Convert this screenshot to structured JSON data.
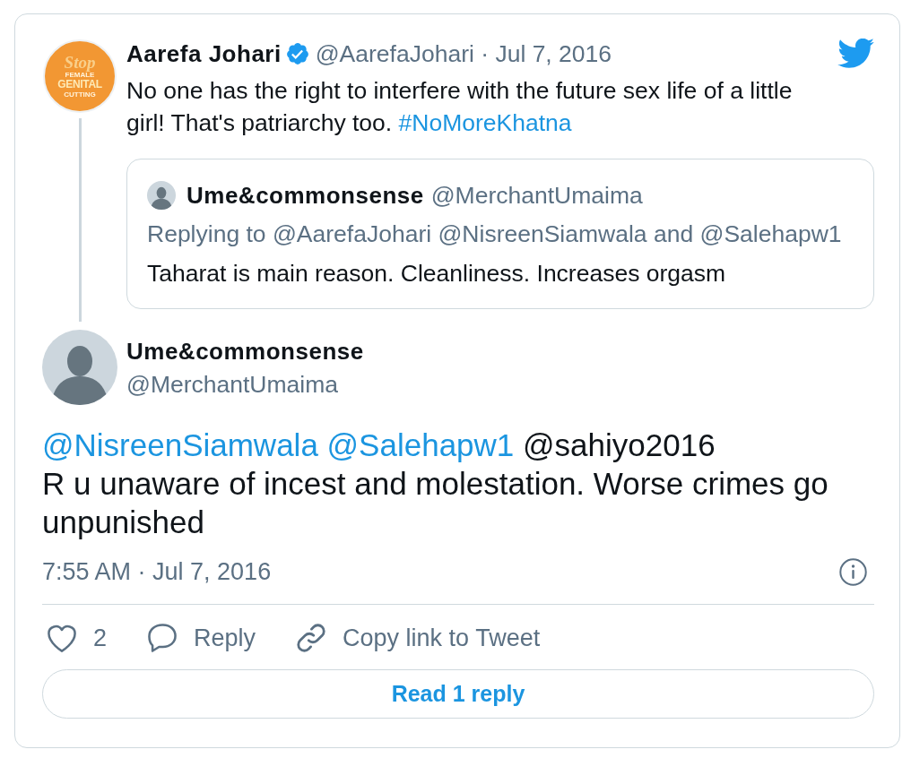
{
  "parent_tweet": {
    "avatar_text": [
      "Stop",
      "FEMALE",
      "GENITAL",
      "CUTTING"
    ],
    "name": "Aarefa Johari",
    "verified": true,
    "handle_date": "@AarefaJohari · Jul 7, 2016",
    "text": [
      {
        "kind": "plain",
        "text": "No one has the right to interfere with the future sex life of a little girl! That's patriarchy too. "
      },
      {
        "kind": "hashtag",
        "text": "#NoMoreKhatna"
      }
    ],
    "quoted_tweet": {
      "name": "Ume&commonsense",
      "handle": "@MerchantUmaima",
      "replying_to": "Replying to @AarefaJohari @NisreenSiamwala and @Salehapw1",
      "text": "Taharat is main reason. Cleanliness. Increases orgasm"
    }
  },
  "tweet": {
    "name": "Ume&commonsense",
    "handle": "@MerchantUmaima",
    "mentions": [
      {
        "text": "@NisreenSiamwala",
        "linked": true
      },
      {
        "text": "@Salehapw1",
        "linked": true
      },
      {
        "text": "@sahiyo2016",
        "linked": false
      }
    ],
    "text": "R u unaware of incest and molestation. Worse crimes go unpunished",
    "timestamp": "7:55 AM · Jul 7, 2016"
  },
  "actions": [
    {
      "kind": "like",
      "label": "2"
    },
    {
      "kind": "reply",
      "label": "Reply"
    },
    {
      "kind": "copy_link",
      "label": "Copy link to Tweet"
    }
  ],
  "read_replies_button": "Read 1 reply"
}
